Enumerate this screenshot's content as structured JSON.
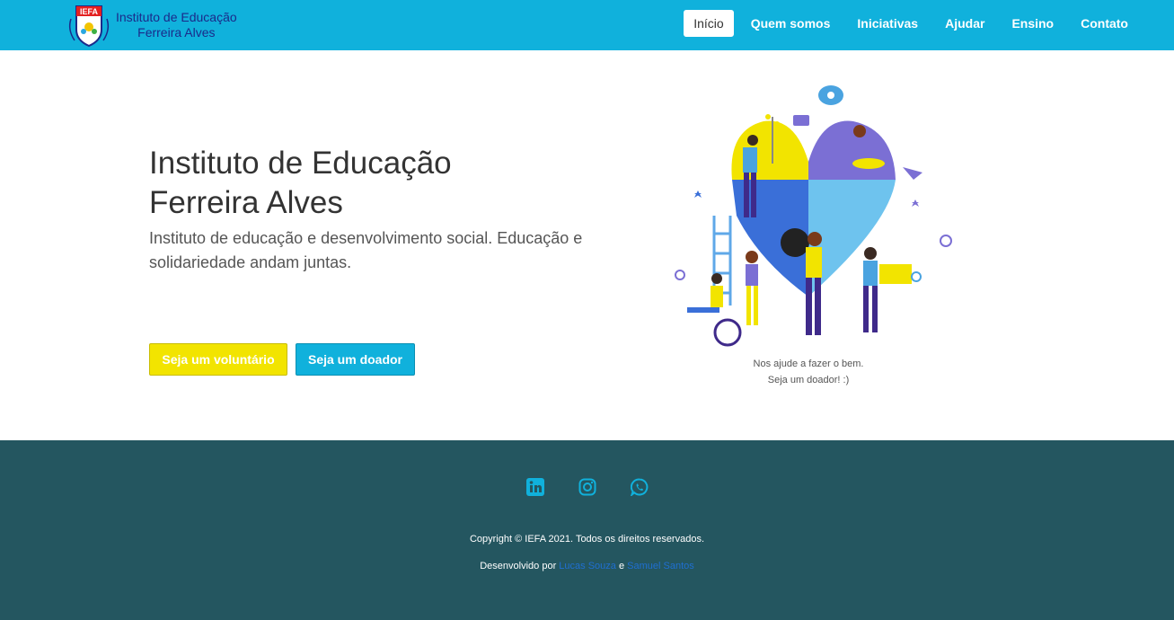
{
  "navbar": {
    "brand_abbrev": "IEFA",
    "brand_line1": "Instituto de Educação",
    "brand_line2": "Ferreira Alves",
    "links": [
      {
        "label": "Início",
        "active": true
      },
      {
        "label": "Quem somos"
      },
      {
        "label": "Iniciativas"
      },
      {
        "label": "Ajudar"
      },
      {
        "label": "Ensino"
      },
      {
        "label": "Contato"
      }
    ],
    "color": "#10b1dc"
  },
  "hero": {
    "title_line1": "Instituto de Educação",
    "title_line2": "Ferreira Alves",
    "subtitle": "Instituto de educação e desenvolvimento social. Educação e solidariedade andam juntas.",
    "volunteer_button": "Seja um voluntário",
    "donor_button": "Seja um doador",
    "caption_line1": "Nos ajude a fazer o bem.",
    "caption_line2": "Seja um doador! :)"
  },
  "footer": {
    "socials": [
      {
        "icon": "linkedin-icon"
      },
      {
        "icon": "instagram-icon"
      },
      {
        "icon": "whatsapp-icon"
      }
    ],
    "copyright": "Copyright © IEFA 2021. Todos os direitos reservados.",
    "developed_by": "Desenvolvido por",
    "author1": "Lucas Souza",
    "conjunction": "e",
    "author2": "Samuel Santos",
    "color": "#245660",
    "icon_color": "#10b1dc"
  },
  "colors": {
    "yellow": "#f2e400",
    "cyan": "#10b1dc",
    "purple": "#7b6fd4",
    "blue": "#3a6fd8"
  }
}
